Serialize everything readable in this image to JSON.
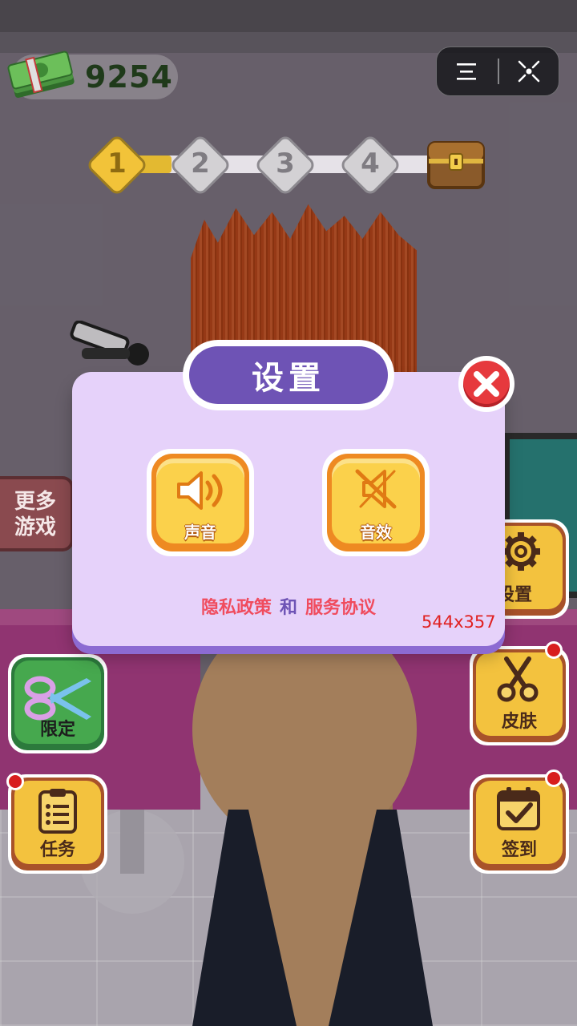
{
  "hud": {
    "money": "9254",
    "levels": [
      "1",
      "2",
      "3",
      "4"
    ],
    "current_level": 1
  },
  "left_buttons": {
    "more_games_line1": "更多",
    "more_games_line2": "游戏",
    "limited": "限定",
    "tasks": "任务"
  },
  "right_buttons": {
    "settings": "设置",
    "skins": "皮肤",
    "checkin": "签到"
  },
  "modal": {
    "title": "设置",
    "sound_label": "声音",
    "sfx_label": "音效",
    "privacy_link": "隐私政策",
    "and_text": "和",
    "terms_link": "服务协议",
    "size_label": "544x357"
  },
  "colors": {
    "modal_bg": "#e6d2fa",
    "title_bg": "#6e53b5",
    "button_face": "#fbd14b",
    "link": "#f04c5e",
    "close": "#e6393d"
  },
  "icons": [
    "money-stack-icon",
    "menu-icon",
    "close-target-icon",
    "treasure-chest-icon",
    "speaker-on-icon",
    "speaker-muted-icon",
    "scissors-icon",
    "clipboard-icon",
    "gear-icon",
    "calendar-check-icon",
    "close-x-icon"
  ]
}
